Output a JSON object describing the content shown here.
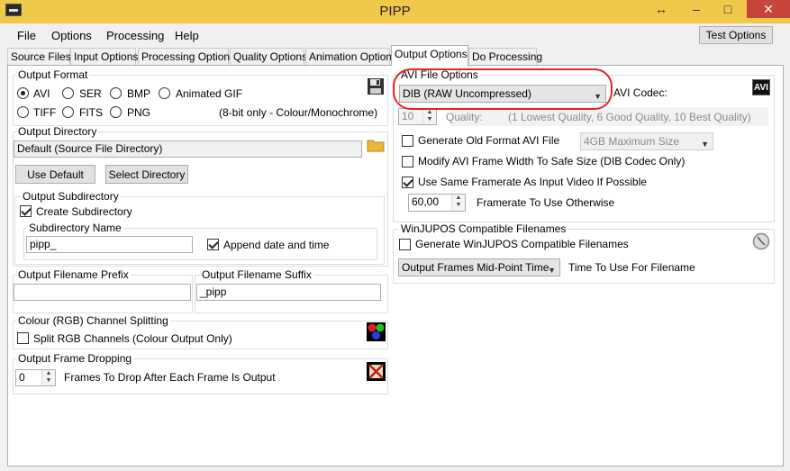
{
  "window": {
    "title": "PIPP",
    "minimize": "–",
    "resize": "↔",
    "maximize": "□",
    "close": "✕"
  },
  "menu": {
    "file": "File",
    "options": "Options",
    "processing": "Processing",
    "help": "Help",
    "test_options": "Test Options"
  },
  "tabs": [
    "Source Files",
    "Input Options",
    "Processing Options",
    "Quality Options",
    "Animation Options",
    "Output Options",
    "Do Processing"
  ],
  "output_format": {
    "title": "Output Format",
    "options": [
      "AVI",
      "SER",
      "BMP",
      "Animated GIF",
      "TIFF",
      "FITS",
      "PNG"
    ],
    "selected": "AVI",
    "note": "(8-bit only - Colour/Monochrome)"
  },
  "output_directory": {
    "title": "Output Directory",
    "value": "Default (Source File Directory)",
    "use_default": "Use Default",
    "select_directory": "Select Directory",
    "subdirectory": {
      "title": "Output Subdirectory",
      "create_label": "Create Subdirectory",
      "create_checked": true,
      "name_title": "Subdirectory Name",
      "name_value": "pipp_",
      "append_label": "Append date and time",
      "append_checked": true
    }
  },
  "filename": {
    "prefix_title": "Output Filename Prefix",
    "prefix_value": "",
    "suffix_title": "Output Filename Suffix",
    "suffix_value": "_pipp"
  },
  "rgb_split": {
    "title": "Colour (RGB) Channel Splitting",
    "label": "Split RGB Channels (Colour Output Only)",
    "checked": false
  },
  "frame_drop": {
    "title": "Output Frame Dropping",
    "value": "0",
    "label": "Frames To Drop After Each Frame Is Output"
  },
  "avi": {
    "title": "AVI File Options",
    "codec_value": "DIB (RAW Uncompressed)",
    "codec_label": "AVI Codec:",
    "avi_badge": "AVI",
    "quality_value": "10",
    "quality_label": "Quality:",
    "quality_hint": "(1 Lowest Quality, 6 Good Quality, 10 Best Quality)",
    "old_format_label": "Generate Old Format AVI File",
    "old_format_checked": false,
    "max_size_value": "4GB Maximum Size",
    "modify_width_label": "Modify AVI Frame Width To Safe Size (DIB Codec Only)",
    "modify_width_checked": false,
    "same_framerate_label": "Use Same Framerate As Input Video If Possible",
    "same_framerate_checked": true,
    "framerate_value": "60,00",
    "framerate_label": "Framerate To Use Otherwise"
  },
  "winjupos": {
    "title": "WinJUPOS Compatible Filenames",
    "generate_label": "Generate WinJUPOS Compatible Filenames",
    "generate_checked": false,
    "time_value": "Output Frames Mid-Point Time",
    "time_label": "Time To Use For Filename"
  },
  "colors": {
    "titlebar": "#f0c84a",
    "close": "#c7453c",
    "highlight": "#e0262b"
  }
}
